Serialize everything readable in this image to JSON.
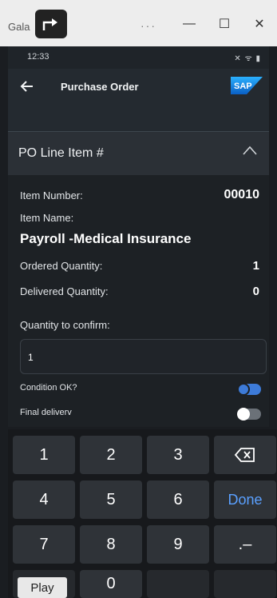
{
  "window": {
    "title": "Gala",
    "dots": "···",
    "minimize": "—",
    "maximize": "☐",
    "close": "✕"
  },
  "status": {
    "time": "12:33",
    "icons": "✕ ᯤ ▮"
  },
  "header": {
    "title": "Purchase Order",
    "logo_text": "SAP"
  },
  "section": {
    "title": "PO Line Item #"
  },
  "fields": {
    "item_number_label": "Item Number:",
    "item_number_value": "00010",
    "item_name_label": "Item Name:",
    "item_name_value": "Payroll -Medical Insurance",
    "ordered_qty_label": "Ordered Quantity:",
    "ordered_qty_value": "1",
    "delivered_qty_label": "Delivered Quantity:",
    "delivered_qty_value": "0",
    "qty_confirm_label": "Quantity to confirm:",
    "qty_confirm_value": "1",
    "condition_ok_label": "Condition OK?",
    "final_delivery_label": "Final deliverv"
  },
  "keypad": {
    "k1": "1",
    "k2": "2",
    "k3": "3",
    "k4": "4",
    "k5": "5",
    "k6": "6",
    "k7": "7",
    "k8": "8",
    "k9": "9",
    "k0": "0",
    "done": "Done",
    "dot_dash": ".–"
  },
  "overlay": {
    "play": "Play"
  },
  "colors": {
    "accent": "#5aa0ff",
    "toggle_on": "#3d7bd9",
    "toggle_off": "#6b7178"
  }
}
